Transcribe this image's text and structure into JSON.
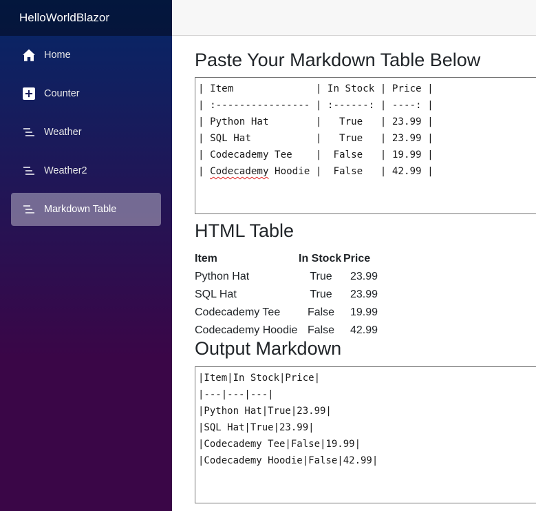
{
  "app": {
    "brand": "HelloWorldBlazor"
  },
  "sidebar": {
    "items": [
      {
        "label": "Home",
        "icon": "home-icon"
      },
      {
        "label": "Counter",
        "icon": "plus-square-icon"
      },
      {
        "label": "Weather",
        "icon": "list-nested-icon"
      },
      {
        "label": "Weather2",
        "icon": "list-nested-icon"
      },
      {
        "label": "Markdown Table",
        "icon": "list-nested-icon",
        "active": true
      }
    ]
  },
  "main": {
    "paste_heading": "Paste Your Markdown Table Below",
    "input_lines": [
      "| Item              | In Stock | Price |",
      "| :---------------- | :------: | ----: |",
      "| Python Hat        |   True   | 23.99 |",
      "| SQL Hat           |   True   | 23.99 |",
      "| Codecademy Tee    |  False   | 19.99 |",
      "| Codecademy Hoodie |  False   | 42.99 |"
    ],
    "html_heading": "HTML Table",
    "table": {
      "headers": [
        "Item",
        "In Stock",
        "Price"
      ],
      "rows": [
        [
          "Python Hat",
          "True",
          "23.99"
        ],
        [
          "SQL Hat",
          "True",
          "23.99"
        ],
        [
          "Codecademy Tee",
          "False",
          "19.99"
        ],
        [
          "Codecademy Hoodie",
          "False",
          "42.99"
        ]
      ]
    },
    "output_heading": "Output Markdown",
    "output_lines": [
      "|Item|In Stock|Price|",
      "|---|---|---|",
      "|Python Hat|True|23.99|",
      "|SQL Hat|True|23.99|",
      "|Codecademy Tee|False|19.99|",
      "|Codecademy Hoodie|False|42.99|"
    ]
  },
  "colors": {
    "sidebar_top": "#052767",
    "sidebar_bottom": "#3a0647",
    "active_item_bg": "#8a7fa6"
  }
}
